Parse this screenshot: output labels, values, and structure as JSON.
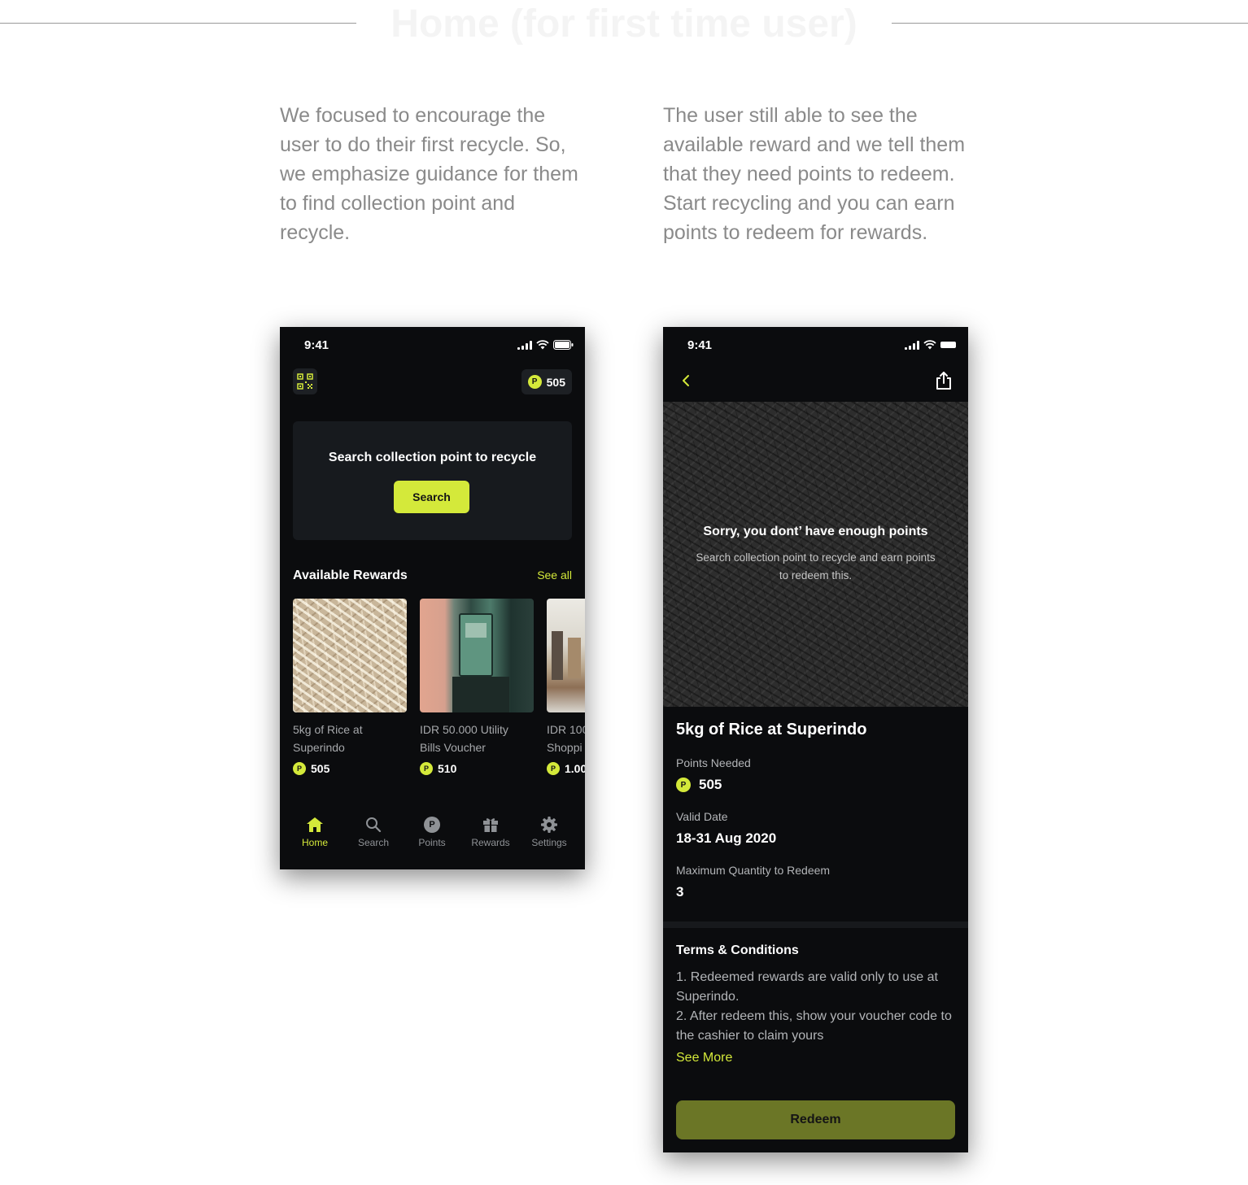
{
  "header": {
    "title": "Home (for first time user)"
  },
  "descriptions": {
    "left": "We focused to encourage the user to do their first recycle. So, we emphasize guidance for them to find collection point and recycle.",
    "right": "The user still able to see the available reward and we tell them that they need points to redeem. Start recycling and you can earn points to redeem for rewards."
  },
  "colors": {
    "accent": "#d4e93a",
    "background": "#0b0c0e",
    "card": "#171a1e",
    "redeem_disabled": "#6b7626"
  },
  "home": {
    "status_time": "9:41",
    "points_badge": "P",
    "points": "505",
    "search_card": {
      "title": "Search collection point to recycle",
      "button": "Search"
    },
    "rewards_title": "Available Rewards",
    "see_all": "See all",
    "rewards": [
      {
        "name_line1": "5kg of Rice at",
        "name_line2": "Superindo",
        "points": "505",
        "image": "rice-photo"
      },
      {
        "name_line1": "IDR 50.000 Utility",
        "name_line2": "Bills Voucher",
        "points": "510",
        "image": "electric-meter-photo"
      },
      {
        "name_line1": "IDR 100",
        "name_line2": "Shoppi",
        "points": "1.00",
        "image": "shop-interior-photo"
      }
    ],
    "nav": [
      {
        "label": "Home",
        "icon": "home-icon",
        "active": true
      },
      {
        "label": "Search",
        "icon": "search-icon"
      },
      {
        "label": "Points",
        "icon": "points-icon"
      },
      {
        "label": "Rewards",
        "icon": "gift-icon"
      },
      {
        "label": "Settings",
        "icon": "gear-icon"
      }
    ]
  },
  "detail": {
    "status_time": "9:41",
    "hero_title": "Sorry, you dont’ have enough points",
    "hero_sub": "Search collection point to recycle and earn points to redeem this.",
    "title": "5kg of Rice at Superindo",
    "points_label": "Points Needed",
    "points_value": "505",
    "valid_label": "Valid Date",
    "valid_value": "18-31 Aug 2020",
    "max_label": "Maximum Quantity to Redeem",
    "max_value": "3",
    "terms_title": "Terms & Conditions",
    "term1": "1. Redeemed rewards are valid only to use at Superindo.",
    "term2": "2. After redeem this, show your voucher code to the cashier to claim yours",
    "see_more": "See More",
    "redeem": "Redeem"
  }
}
